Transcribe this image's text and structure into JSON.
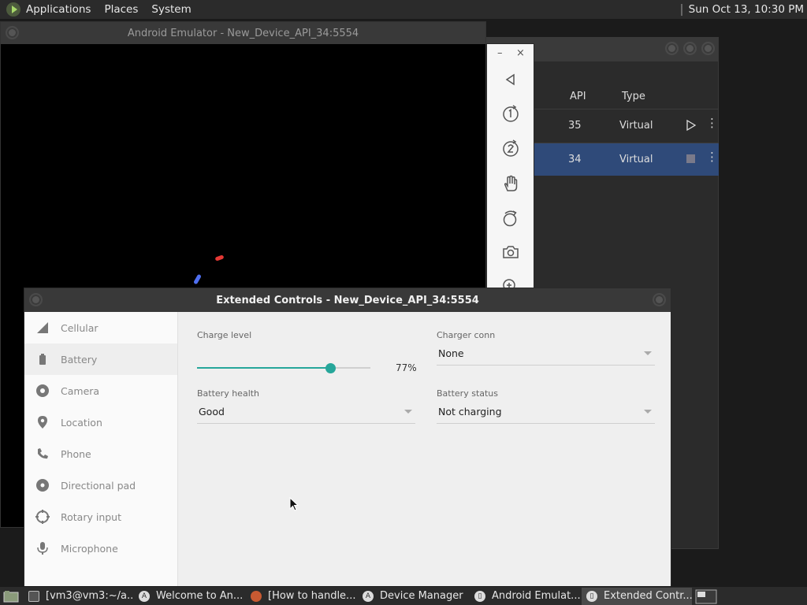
{
  "top_panel": {
    "menus": [
      "Applications",
      "Places",
      "System"
    ],
    "clock": "Sun Oct 13, 10:30 PM"
  },
  "device_manager": {
    "col_api": "API",
    "col_type": "Type",
    "rows": [
      {
        "api": "35",
        "type": "Virtual",
        "action": "▷",
        "menu": "⋮",
        "selected": false
      },
      {
        "api": "34",
        "type": "Virtual",
        "action": "■",
        "menu": "⋮",
        "selected": true
      }
    ]
  },
  "emulator": {
    "title": "Android Emulator - New_Device_API_34:5554",
    "dot_colors": [
      "#e53935",
      "#4f6ff0",
      "#f2c02c"
    ]
  },
  "toolbar": {
    "minimize": "–",
    "close": "×",
    "buttons": [
      "back-icon",
      "rotate-left-icon",
      "rotate-right-icon",
      "gesture-hand-icon",
      "rotate-device-icon",
      "screenshot-icon",
      "zoom-icon",
      "more-icon"
    ]
  },
  "extended_controls": {
    "title": "Extended Controls - New_Device_API_34:5554",
    "sidebar": [
      {
        "label": "Cellular",
        "icon": "cellular-icon"
      },
      {
        "label": "Battery",
        "icon": "battery-icon",
        "active": true
      },
      {
        "label": "Camera",
        "icon": "camera-icon"
      },
      {
        "label": "Location",
        "icon": "location-icon"
      },
      {
        "label": "Phone",
        "icon": "phone-icon"
      },
      {
        "label": "Directional pad",
        "icon": "dpad-icon"
      },
      {
        "label": "Rotary input",
        "icon": "rotary-icon"
      },
      {
        "label": "Microphone",
        "icon": "microphone-icon"
      }
    ],
    "charge_level_label": "Charge level",
    "charge_level_value": "77%",
    "charge_level_fraction": 0.77,
    "charger_connection_label": "Charger conn",
    "charger_connection_value": "None",
    "battery_health_label": "Battery health",
    "battery_health_value": "Good",
    "battery_status_label": "Battery status",
    "battery_status_value": "Not charging",
    "accent_color": "#26a69a"
  },
  "taskbar": {
    "items": [
      {
        "label": "[vm3@vm3:~/a...",
        "icon": "terminal-icon"
      },
      {
        "label": "Welcome to An...",
        "icon": "android-studio-icon"
      },
      {
        "label": "[How to handle...",
        "icon": "firefox-icon"
      },
      {
        "label": "Device Manager",
        "icon": "android-studio-icon"
      },
      {
        "label": "Android Emulat...",
        "icon": "emulator-icon"
      },
      {
        "label": "Extended Contr...",
        "icon": "emulator-icon",
        "active": true
      }
    ]
  }
}
